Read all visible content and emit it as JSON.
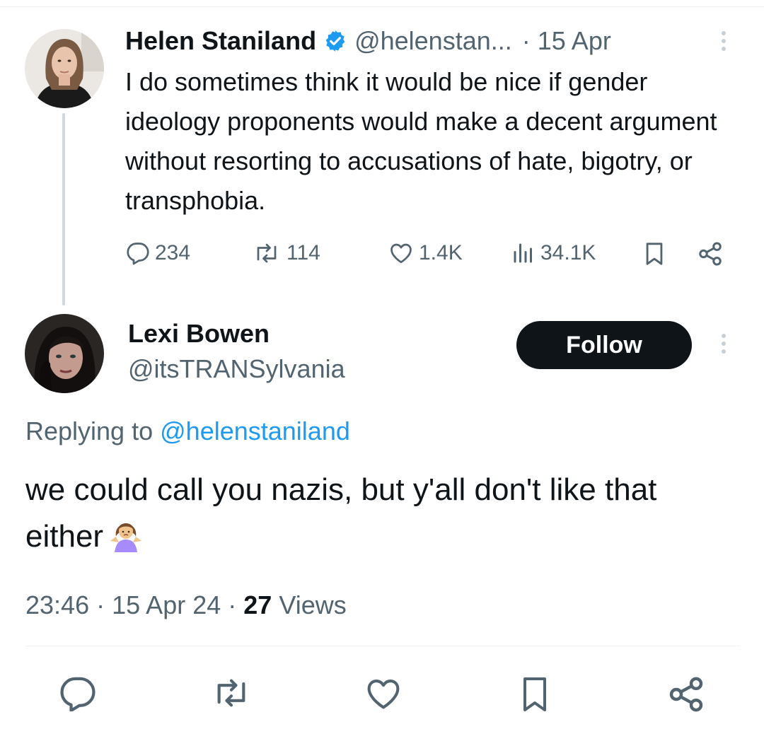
{
  "parent_tweet": {
    "author_name": "Helen Staniland",
    "verified": true,
    "handle": "@helenstan...",
    "separator": "·",
    "date": "15 Apr",
    "text": "I do sometimes think it would be nice if gender ideology proponents would make a decent argument without resorting to accusations of hate, bigotry, or transphobia.",
    "stats": {
      "replies": "234",
      "reposts": "114",
      "likes": "1.4K",
      "views": "34.1K"
    }
  },
  "main_tweet": {
    "author_name": "Lexi Bowen",
    "handle": "@itsTRANSylvania",
    "follow_label": "Follow",
    "replying_to_prefix": "Replying to",
    "replying_to_handle": "@helenstaniland",
    "text": "we could call you nazis, but y'all don't like that either",
    "emoji_icon": "person-shrugging-emoji",
    "time": "23:46",
    "date": "15 Apr 24",
    "dot": "·",
    "views_count": "27",
    "views_label": "Views"
  },
  "colors": {
    "accent": "#1d9bf0",
    "text_primary": "#0f1419",
    "text_secondary": "#536471",
    "button_bg": "#0f1419",
    "divider": "#eff3f4"
  }
}
